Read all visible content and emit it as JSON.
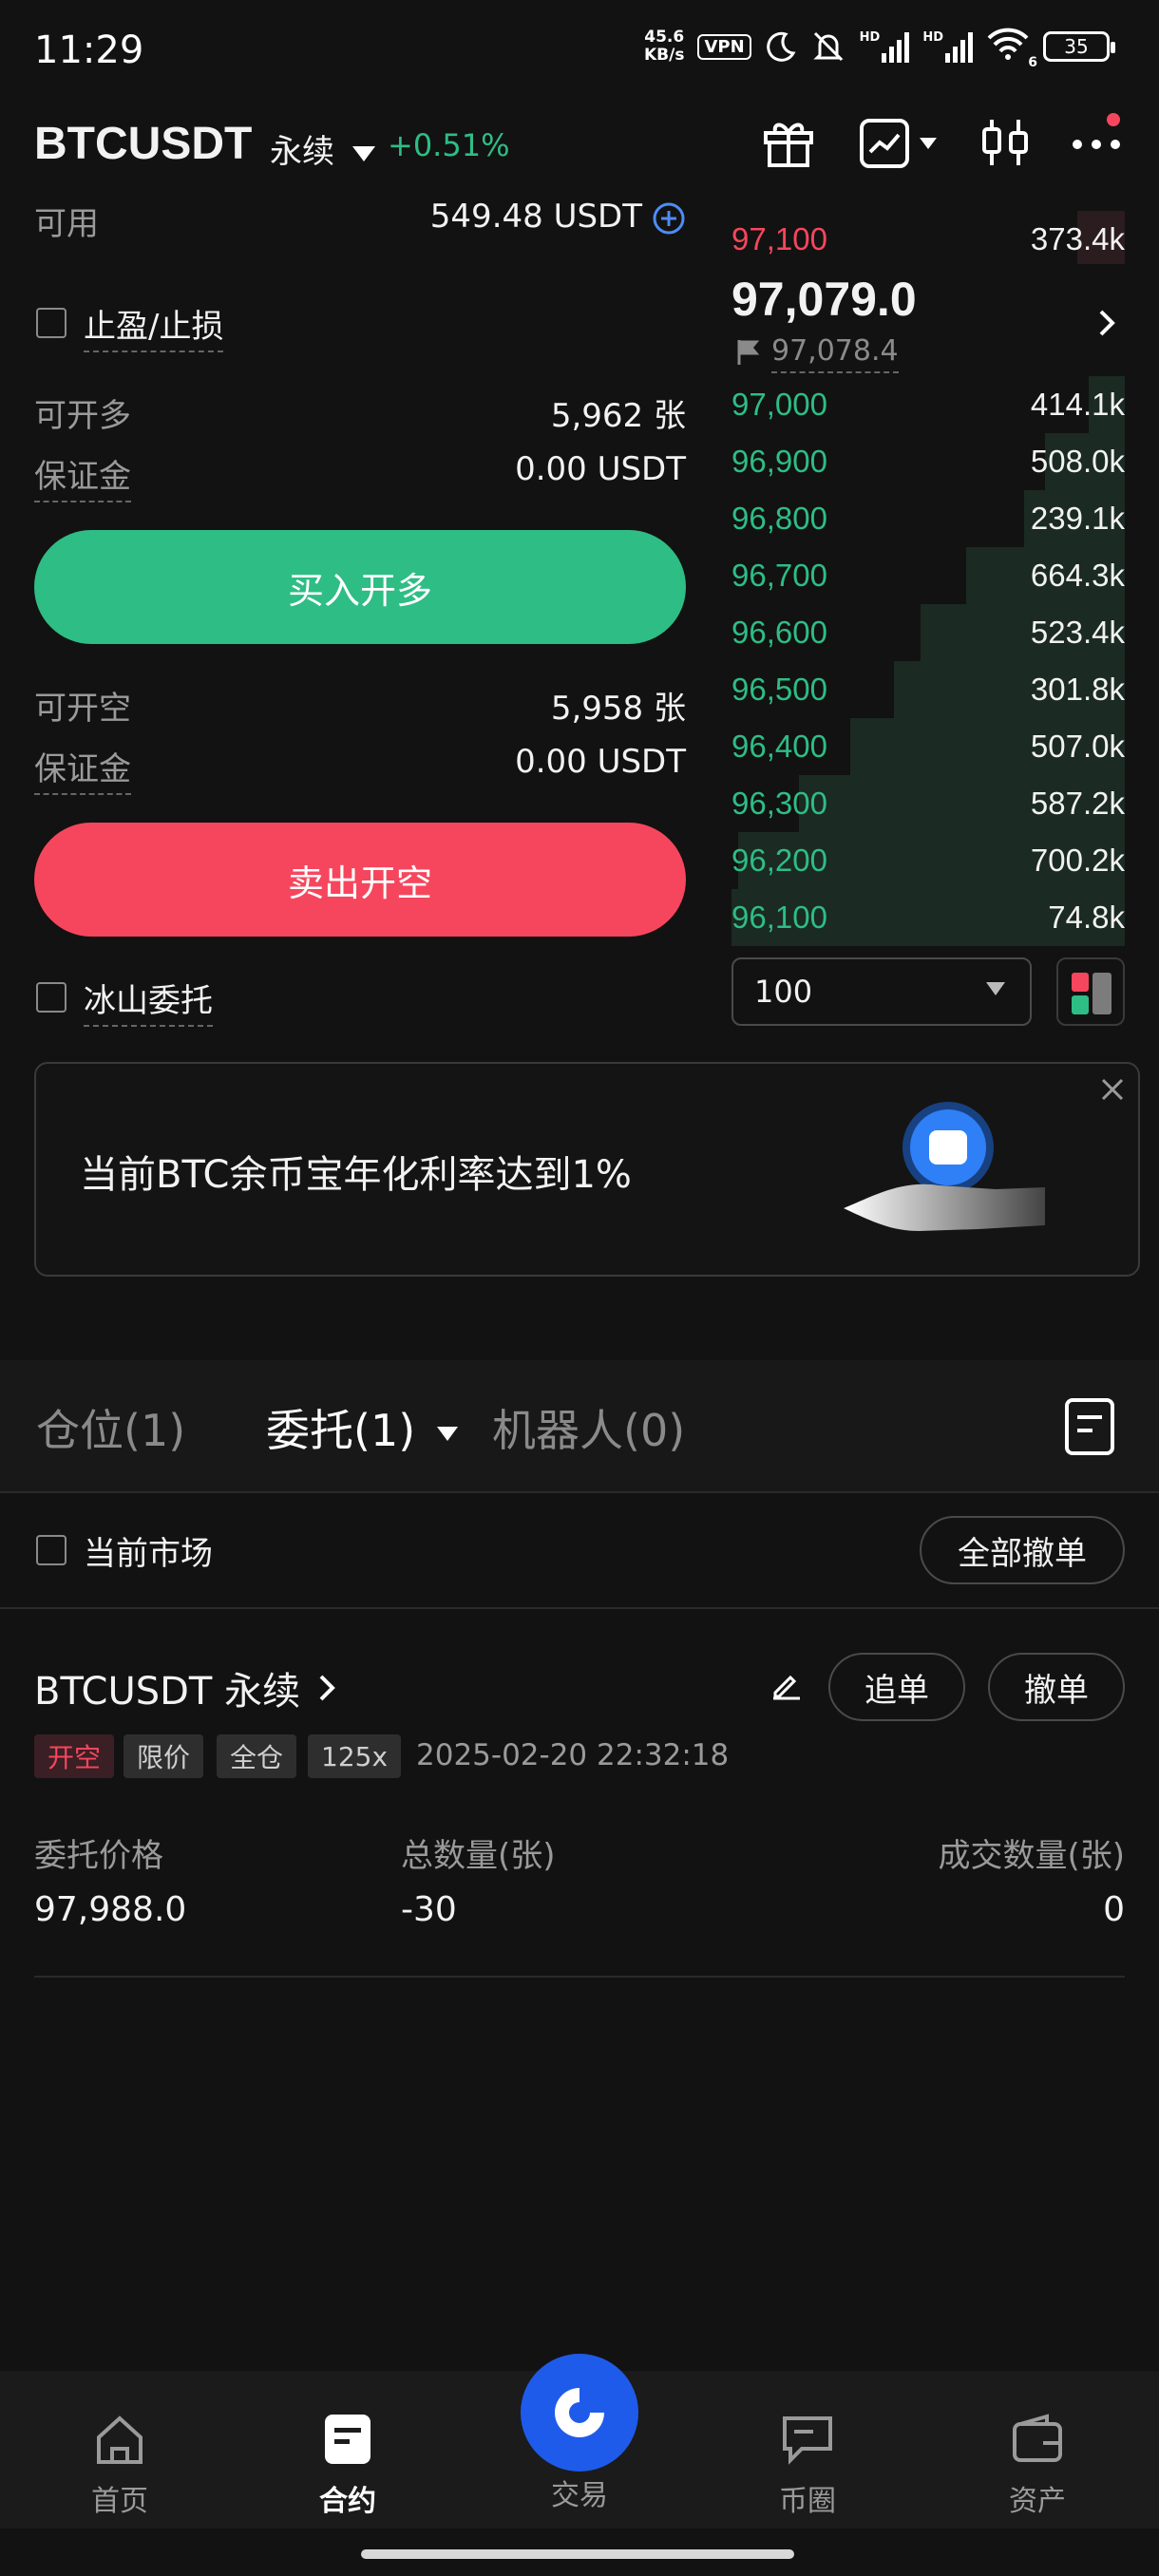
{
  "status_bar": {
    "time": "11:29",
    "net_speed_value": "45.6",
    "net_speed_unit": "KB/s",
    "vpn": "VPN",
    "hd": "HD",
    "wifi_badge": "6",
    "battery": "35"
  },
  "header": {
    "pair": "BTCUSDT",
    "contract_type": "永续",
    "change": "+0.51%"
  },
  "account": {
    "available_label": "可用",
    "available_value": "549.48 USDT"
  },
  "tp_sl_label": "止盈/止损",
  "long": {
    "openable_label": "可开多",
    "openable_value": "5,962 张",
    "margin_label": "保证金",
    "margin_value": "0.00 USDT",
    "button": "买入开多"
  },
  "short": {
    "openable_label": "可开空",
    "openable_value": "5,958 张",
    "margin_label": "保证金",
    "margin_value": "0.00 USDT",
    "button": "卖出开空"
  },
  "iceberg_label": "冰山委托",
  "orderbook": {
    "ask": {
      "price": "97,100",
      "qty": "373.4k"
    },
    "last_price": "97,079.0",
    "mark_price": "97,078.4",
    "bids": [
      {
        "price": "97,000",
        "qty": "414.1k"
      },
      {
        "price": "96,900",
        "qty": "508.0k"
      },
      {
        "price": "96,800",
        "qty": "239.1k"
      },
      {
        "price": "96,700",
        "qty": "664.3k"
      },
      {
        "price": "96,600",
        "qty": "523.4k"
      },
      {
        "price": "96,500",
        "qty": "301.8k"
      },
      {
        "price": "96,400",
        "qty": "507.0k"
      },
      {
        "price": "96,300",
        "qty": "587.2k"
      },
      {
        "price": "96,200",
        "qty": "700.2k"
      },
      {
        "price": "96,100",
        "qty": "74.8k"
      }
    ],
    "precision": "100"
  },
  "banner": {
    "text": "当前BTC余币宝年化利率达到1%"
  },
  "tabs": {
    "positions": "仓位(1)",
    "orders": "委托(1)",
    "bots": "机器人(0)"
  },
  "filter": {
    "current_market": "当前市场",
    "cancel_all": "全部撤单"
  },
  "order": {
    "symbol": "BTCUSDT 永续",
    "chase": "追单",
    "cancel": "撤单",
    "tags": [
      "开空",
      "限价",
      "全仓",
      "125x"
    ],
    "datetime": "2025-02-20 22:32:18",
    "price_label": "委托价格",
    "price_value": "97,988.0",
    "qty_label": "总数量(张)",
    "qty_value": "-30",
    "filled_label": "成交数量(张)",
    "filled_value": "0"
  },
  "nav": {
    "home": "首页",
    "contract": "合约",
    "trade": "交易",
    "community": "币圈",
    "assets": "资产"
  },
  "colors": {
    "green": "#2ebd85",
    "red": "#f6465d",
    "accent_blue": "#1f5bea"
  }
}
